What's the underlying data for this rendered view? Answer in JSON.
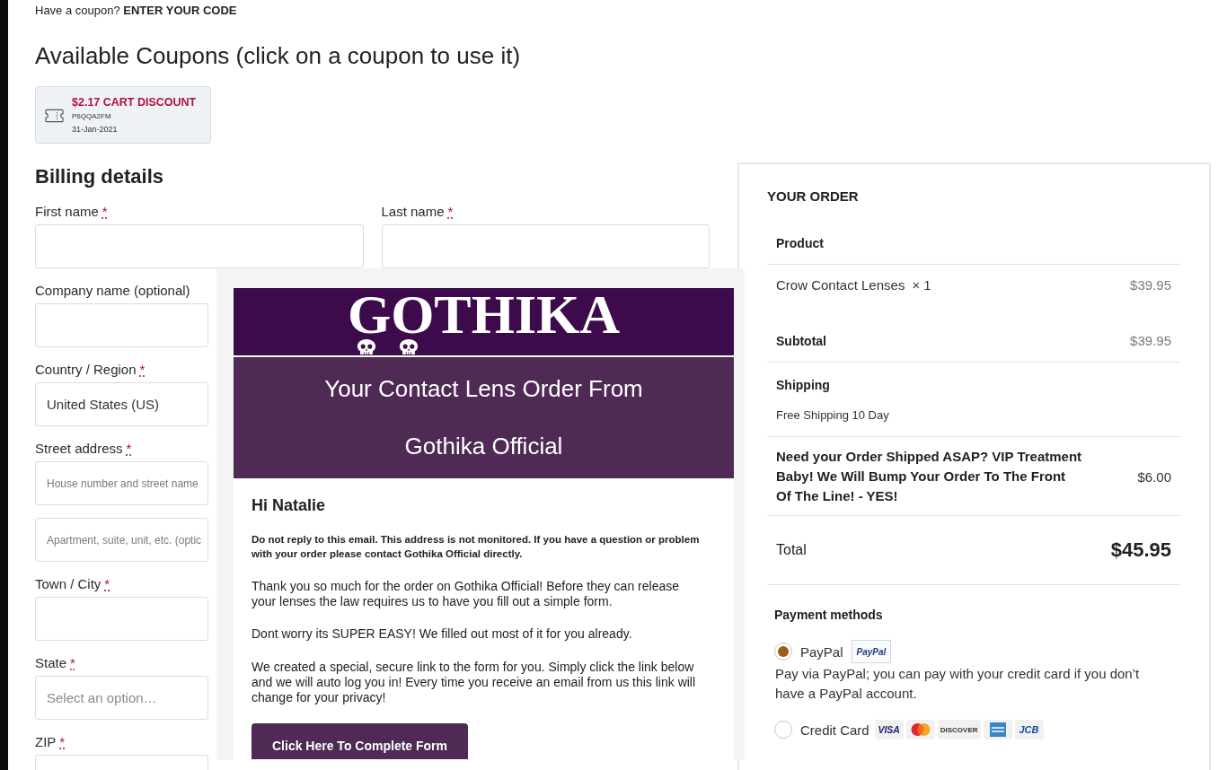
{
  "coupon_prompt": {
    "text": "Have a coupon?",
    "link": "ENTER YOUR CODE"
  },
  "available_coupons": {
    "title": "Available Coupons (click on a coupon to use it)",
    "coupons": [
      {
        "amount": "$2.17 CART DISCOUNT",
        "code": "P6QQA2FM",
        "expires": "31-Jan-2021"
      }
    ]
  },
  "billing": {
    "title": "Billing details",
    "name_row": [
      {
        "label": "First name",
        "required_mark": "*"
      },
      {
        "label": "Last name",
        "required_mark": "*"
      }
    ],
    "fields": [
      {
        "kind": "text",
        "label": "Company name (optional)"
      },
      {
        "kind": "select",
        "label": "Country / Region",
        "required_mark": "*",
        "value": "United States (US)"
      },
      {
        "kind": "multi",
        "label": "Street address",
        "required_mark": "*",
        "placeholders": [
          "House number and street name",
          "Apartment, suite, unit, etc. (optic"
        ]
      },
      {
        "kind": "text",
        "label": "Town / City",
        "required_mark": "*"
      },
      {
        "kind": "select",
        "label": "State",
        "required_mark": "*",
        "placeholder": "Select an option…"
      },
      {
        "kind": "text",
        "label": "ZIP",
        "required_mark": "*"
      }
    ]
  },
  "email_preview": {
    "logo": "GOTHIKA",
    "heading_lines": [
      "Your Contact Lens Order From",
      "Gothika Official"
    ],
    "greeting": "Hi Natalie",
    "notice": "Do not reply to this email. This address is not monitored. If you have a question or problem with your order please contact Gothika Official directly.",
    "paragraphs": [
      "Thank you so much for the order on Gothika Official! Before they can release your lenses the law requires us to have you fill out a simple form.",
      "Dont worry its SUPER EASY! We filled out most of it for you already.",
      "We created a special, secure link to the form for you. Simply click the link below and we will auto log you in! Every time you receive an email from us this link will change for your privacy!"
    ],
    "button": "Click Here To Complete Form"
  },
  "order": {
    "title": "YOUR ORDER",
    "header": "Product",
    "items": [
      {
        "name": "Crow Contact Lenses",
        "quantity": "× 1",
        "price": "$39.95"
      }
    ],
    "subtotal": {
      "label": "Subtotal",
      "value": "$39.95"
    },
    "shipping": {
      "label": "Shipping",
      "option": "Free Shipping 10 Day"
    },
    "fees": [
      {
        "label": "Need your Order Shipped ASAP? VIP Treatment Baby! We Will Bump Your Order To The Front Of The Line! - YES!",
        "value": "$6.00"
      }
    ],
    "total": {
      "label": "Total",
      "value": "$45.95"
    }
  },
  "payment": {
    "title": "Payment methods",
    "methods": [
      {
        "label": "PayPal",
        "selected": true,
        "badge": "PayPal",
        "description": "Pay via PayPal; you can pay with your credit card if you don’t have a PayPal account."
      },
      {
        "label": "Credit Card",
        "selected": false,
        "card_logos": [
          {
            "kind": "visa",
            "label": "VISA"
          },
          {
            "kind": "mastercard"
          },
          {
            "kind": "discover",
            "label": "DISCOVER"
          },
          {
            "kind": "amex"
          },
          {
            "kind": "jcb",
            "label": "JCB"
          }
        ]
      }
    ]
  }
}
